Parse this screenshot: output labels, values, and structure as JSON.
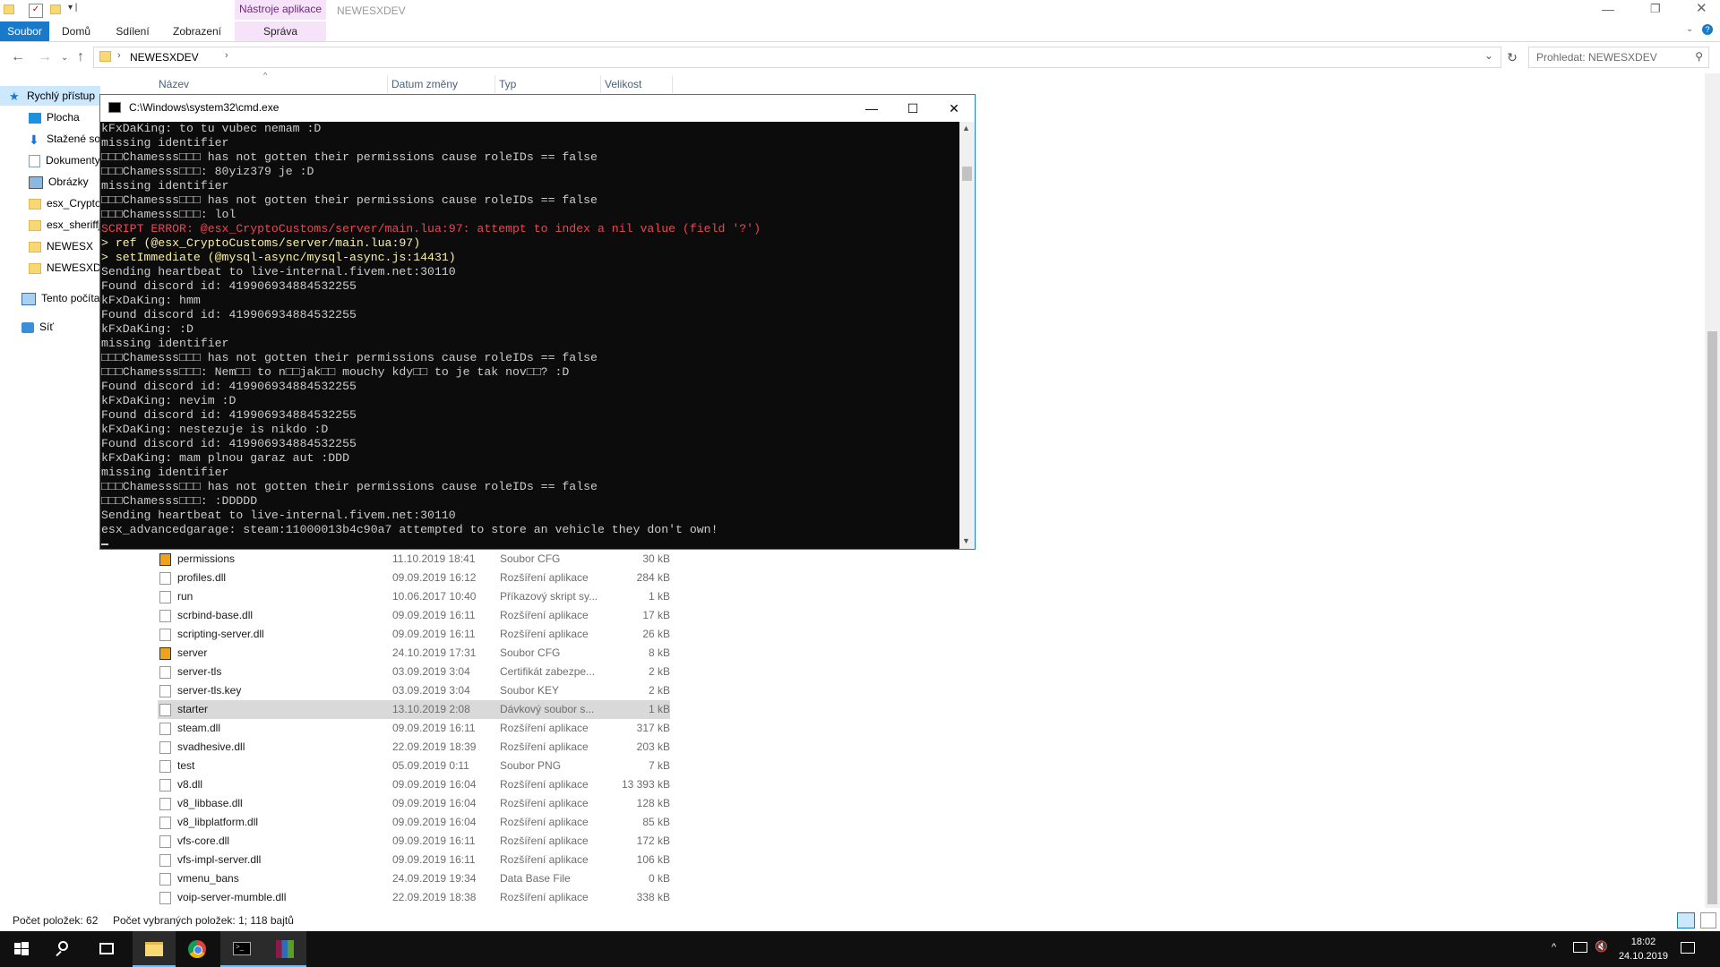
{
  "explorer": {
    "ribbon": {
      "tabs": [
        "Soubor",
        "Domů",
        "Sdílení",
        "Zobrazení"
      ],
      "contextual_header": "Nástroje aplikace",
      "contextual_tab": "Správa",
      "window_title": "NEWESXDEV"
    },
    "address": {
      "path": "NEWESXDEV",
      "search_placeholder": "Prohledat: NEWESXDEV"
    },
    "columns": [
      "Název",
      "Datum změny",
      "Typ",
      "Velikost"
    ],
    "nav": [
      {
        "label": "Rychlý přístup",
        "icon": "star-icon"
      },
      {
        "label": "Plocha",
        "icon": "desktop-icon"
      },
      {
        "label": "Stažené soubory",
        "icon": "download-icon"
      },
      {
        "label": "Dokumenty",
        "icon": "document-icon"
      },
      {
        "label": "Obrázky",
        "icon": "picture-icon"
      },
      {
        "label": "esx_CryptoCustoms",
        "icon": "folder-icon"
      },
      {
        "label": "esx_sheriffjob",
        "icon": "folder-icon"
      },
      {
        "label": "NEWESX",
        "icon": "folder-icon"
      },
      {
        "label": "NEWESXDEV",
        "icon": "folder-icon"
      },
      {
        "label": "Tento počítač",
        "icon": "computer-icon"
      },
      {
        "label": "Síť",
        "icon": "network-icon"
      }
    ],
    "files": [
      {
        "name": "permissions",
        "date": "11.10.2019 18:41",
        "type": "Soubor CFG",
        "size": "30 kB",
        "icon": "cfg"
      },
      {
        "name": "profiles.dll",
        "date": "09.09.2019 16:12",
        "type": "Rozšíření aplikace",
        "size": "284 kB",
        "icon": "file"
      },
      {
        "name": "run",
        "date": "10.06.2017 10:40",
        "type": "Příkazový skript sy...",
        "size": "1 kB",
        "icon": "file"
      },
      {
        "name": "scrbind-base.dll",
        "date": "09.09.2019 16:11",
        "type": "Rozšíření aplikace",
        "size": "17 kB",
        "icon": "file"
      },
      {
        "name": "scripting-server.dll",
        "date": "09.09.2019 16:11",
        "type": "Rozšíření aplikace",
        "size": "26 kB",
        "icon": "file"
      },
      {
        "name": "server",
        "date": "24.10.2019 17:31",
        "type": "Soubor CFG",
        "size": "8 kB",
        "icon": "cfg"
      },
      {
        "name": "server-tls",
        "date": "03.09.2019 3:04",
        "type": "Certifikát zabezpe...",
        "size": "2 kB",
        "icon": "file"
      },
      {
        "name": "server-tls.key",
        "date": "03.09.2019 3:04",
        "type": "Soubor KEY",
        "size": "2 kB",
        "icon": "file"
      },
      {
        "name": "starter",
        "date": "13.10.2019 2:08",
        "type": "Dávkový soubor s...",
        "size": "1 kB",
        "icon": "file",
        "selected": true
      },
      {
        "name": "steam.dll",
        "date": "09.09.2019 16:11",
        "type": "Rozšíření aplikace",
        "size": "317 kB",
        "icon": "file"
      },
      {
        "name": "svadhesive.dll",
        "date": "22.09.2019 18:39",
        "type": "Rozšíření aplikace",
        "size": "203 kB",
        "icon": "file"
      },
      {
        "name": "test",
        "date": "05.09.2019 0:11",
        "type": "Soubor PNG",
        "size": "7 kB",
        "icon": "file"
      },
      {
        "name": "v8.dll",
        "date": "09.09.2019 16:04",
        "type": "Rozšíření aplikace",
        "size": "13 393 kB",
        "icon": "file"
      },
      {
        "name": "v8_libbase.dll",
        "date": "09.09.2019 16:04",
        "type": "Rozšíření aplikace",
        "size": "128 kB",
        "icon": "file"
      },
      {
        "name": "v8_libplatform.dll",
        "date": "09.09.2019 16:04",
        "type": "Rozšíření aplikace",
        "size": "85 kB",
        "icon": "file"
      },
      {
        "name": "vfs-core.dll",
        "date": "09.09.2019 16:11",
        "type": "Rozšíření aplikace",
        "size": "172 kB",
        "icon": "file"
      },
      {
        "name": "vfs-impl-server.dll",
        "date": "09.09.2019 16:11",
        "type": "Rozšíření aplikace",
        "size": "106 kB",
        "icon": "file"
      },
      {
        "name": "vmenu_bans",
        "date": "24.09.2019 19:34",
        "type": "Data Base File",
        "size": "0 kB",
        "icon": "file"
      },
      {
        "name": "voip-server-mumble.dll",
        "date": "22.09.2019 18:38",
        "type": "Rozšíření aplikace",
        "size": "338 kB",
        "icon": "file"
      }
    ],
    "status": {
      "count": "Počet položek: 62",
      "selected": "Počet vybraných položek: 1; 118 bajtů"
    }
  },
  "cmd": {
    "title": "C:\\Windows\\system32\\cmd.exe",
    "lines": [
      {
        "text": "kFxDaKing: to tu vubec nemam :D",
        "style": ""
      },
      {
        "text": "missing identifier",
        "style": ""
      },
      {
        "text": "□□□Chamesss□□□ has not gotten their permissions cause roleIDs == false",
        "style": ""
      },
      {
        "text": "□□□Chamesss□□□: 80yiz379 je :D",
        "style": ""
      },
      {
        "text": "missing identifier",
        "style": ""
      },
      {
        "text": "□□□Chamesss□□□ has not gotten their permissions cause roleIDs == false",
        "style": ""
      },
      {
        "text": "□□□Chamesss□□□: lol",
        "style": ""
      },
      {
        "text": "SCRIPT ERROR: @esx_CryptoCustoms/server/main.lua:97: attempt to index a nil value (field '?')",
        "style": "red"
      },
      {
        "text": "> ref (@esx_CryptoCustoms/server/main.lua:97)",
        "style": "ref"
      },
      {
        "text": "> setImmediate (@mysql-async/mysql-async.js:14431)",
        "style": "setimm"
      },
      {
        "text": "Sending heartbeat to live-internal.fivem.net:30110",
        "style": ""
      },
      {
        "text": "Found discord id: 419906934884532255",
        "style": ""
      },
      {
        "text": "kFxDaKing: hmm",
        "style": ""
      },
      {
        "text": "Found discord id: 419906934884532255",
        "style": ""
      },
      {
        "text": "kFxDaKing: :D",
        "style": ""
      },
      {
        "text": "missing identifier",
        "style": ""
      },
      {
        "text": "□□□Chamesss□□□ has not gotten their permissions cause roleIDs == false",
        "style": ""
      },
      {
        "text": "□□□Chamesss□□□: Nem□□ to n□□jak□□ mouchy kdy□□ to je tak nov□□? :D",
        "style": ""
      },
      {
        "text": "Found discord id: 419906934884532255",
        "style": ""
      },
      {
        "text": "kFxDaKing: nevim :D",
        "style": ""
      },
      {
        "text": "Found discord id: 419906934884532255",
        "style": ""
      },
      {
        "text": "kFxDaKing: nestezuje is nikdo :D",
        "style": ""
      },
      {
        "text": "Found discord id: 419906934884532255",
        "style": ""
      },
      {
        "text": "kFxDaKing: mam plnou garaz aut :DDD",
        "style": ""
      },
      {
        "text": "missing identifier",
        "style": ""
      },
      {
        "text": "□□□Chamesss□□□ has not gotten their permissions cause roleIDs == false",
        "style": ""
      },
      {
        "text": "□□□Chamesss□□□: :DDDDD",
        "style": ""
      },
      {
        "text": "Sending heartbeat to live-internal.fivem.net:30110",
        "style": ""
      },
      {
        "text": "esx_advancedgarage: steam:11000013b4c90a7 attempted to store an vehicle they don't own!",
        "style": ""
      }
    ]
  },
  "taskbar": {
    "time": "18:02",
    "date": "24.10.2019"
  }
}
